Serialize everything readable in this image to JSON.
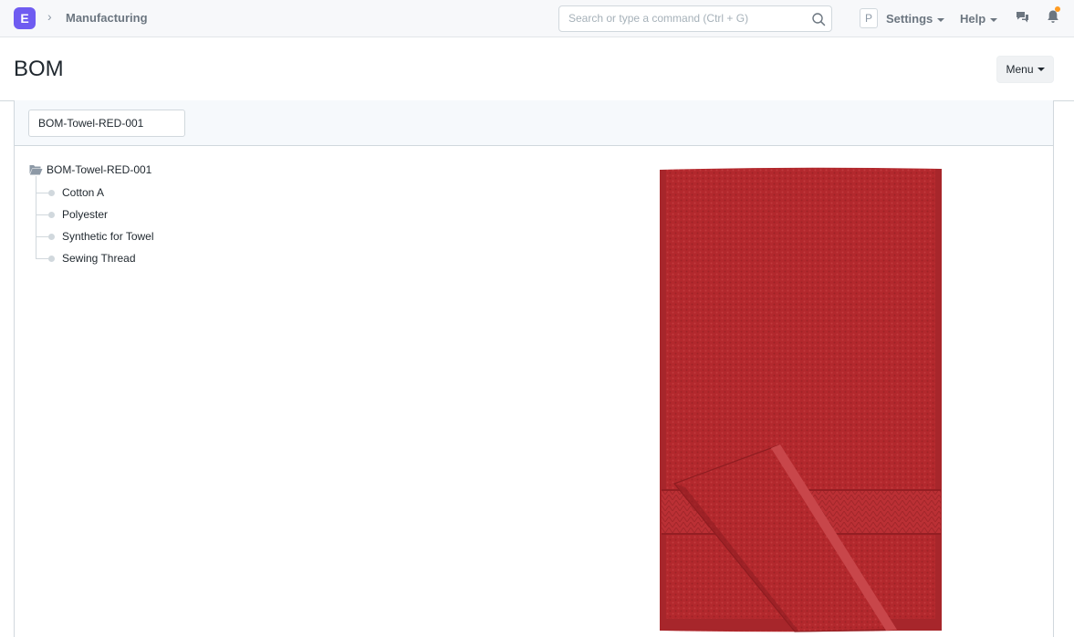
{
  "navbar": {
    "logo_letter": "E",
    "breadcrumb": "Manufacturing",
    "search_placeholder": "Search or type a command (Ctrl + G)",
    "avatar_letter": "P",
    "settings_label": "Settings",
    "help_label": "Help"
  },
  "page": {
    "title": "BOM",
    "menu_label": "Menu"
  },
  "filter": {
    "bom_value": "BOM-Towel-RED-001"
  },
  "tree": {
    "root": "BOM-Towel-RED-001",
    "children": [
      {
        "label": "Cotton A"
      },
      {
        "label": "Polyester"
      },
      {
        "label": "Synthetic for Towel"
      },
      {
        "label": "Sewing Thread"
      }
    ]
  },
  "colors": {
    "brand": "#6f5cf1",
    "towel": "#b3282d",
    "notification": "#ff9b21"
  }
}
